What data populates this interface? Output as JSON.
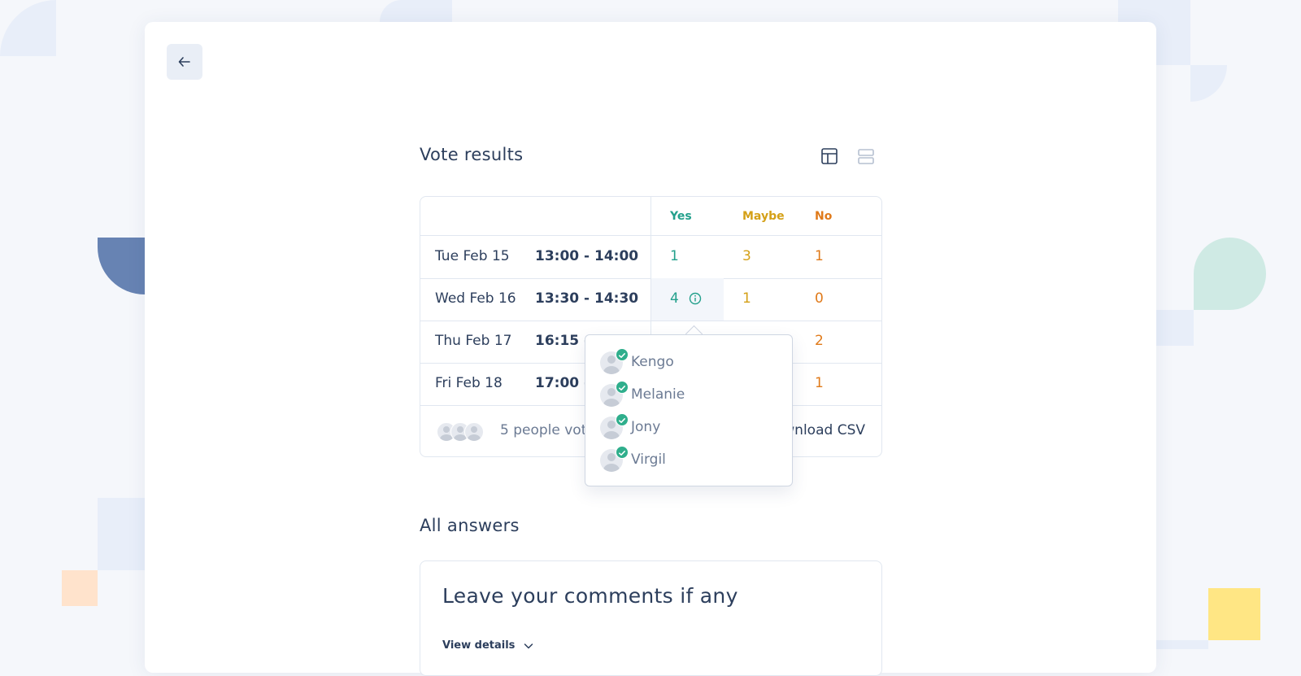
{
  "navigation": {
    "back_icon": "arrow-left-icon"
  },
  "vote_results": {
    "title": "Vote results",
    "view_icons": [
      "table-layout-icon",
      "list-layout-icon"
    ],
    "columns": {
      "yes": "Yes",
      "maybe": "Maybe",
      "no": "No"
    },
    "rows": [
      {
        "date": "Tue Feb 15",
        "time": "13:00 - 14:00",
        "yes": "1",
        "maybe": "3",
        "no": "1"
      },
      {
        "date": "Wed Feb 16",
        "time": "13:30 - 14:30",
        "yes": "4",
        "maybe": "1",
        "no": "0"
      },
      {
        "date": "Thu Feb 17",
        "time": "16:15 - 1",
        "yes": "",
        "maybe": "",
        "no": "2"
      },
      {
        "date": "Fri Feb 18",
        "time": "17:00 -",
        "yes": "",
        "maybe": "",
        "no": "1"
      }
    ],
    "footer": {
      "voted_text": "5 people vot",
      "csv_label": "wnload CSV"
    }
  },
  "voters_popover": {
    "voters": [
      {
        "name": "Kengo"
      },
      {
        "name": "Melanie"
      },
      {
        "name": "Jony"
      },
      {
        "name": "Virgil"
      }
    ]
  },
  "all_answers": {
    "title": "All answers",
    "comments_title": "Leave your comments if any",
    "view_details_label": "View details"
  },
  "colors": {
    "yes": "#23a08c",
    "maybe": "#d4a017",
    "no": "#e07a1a",
    "text": "#2c3e5c"
  }
}
